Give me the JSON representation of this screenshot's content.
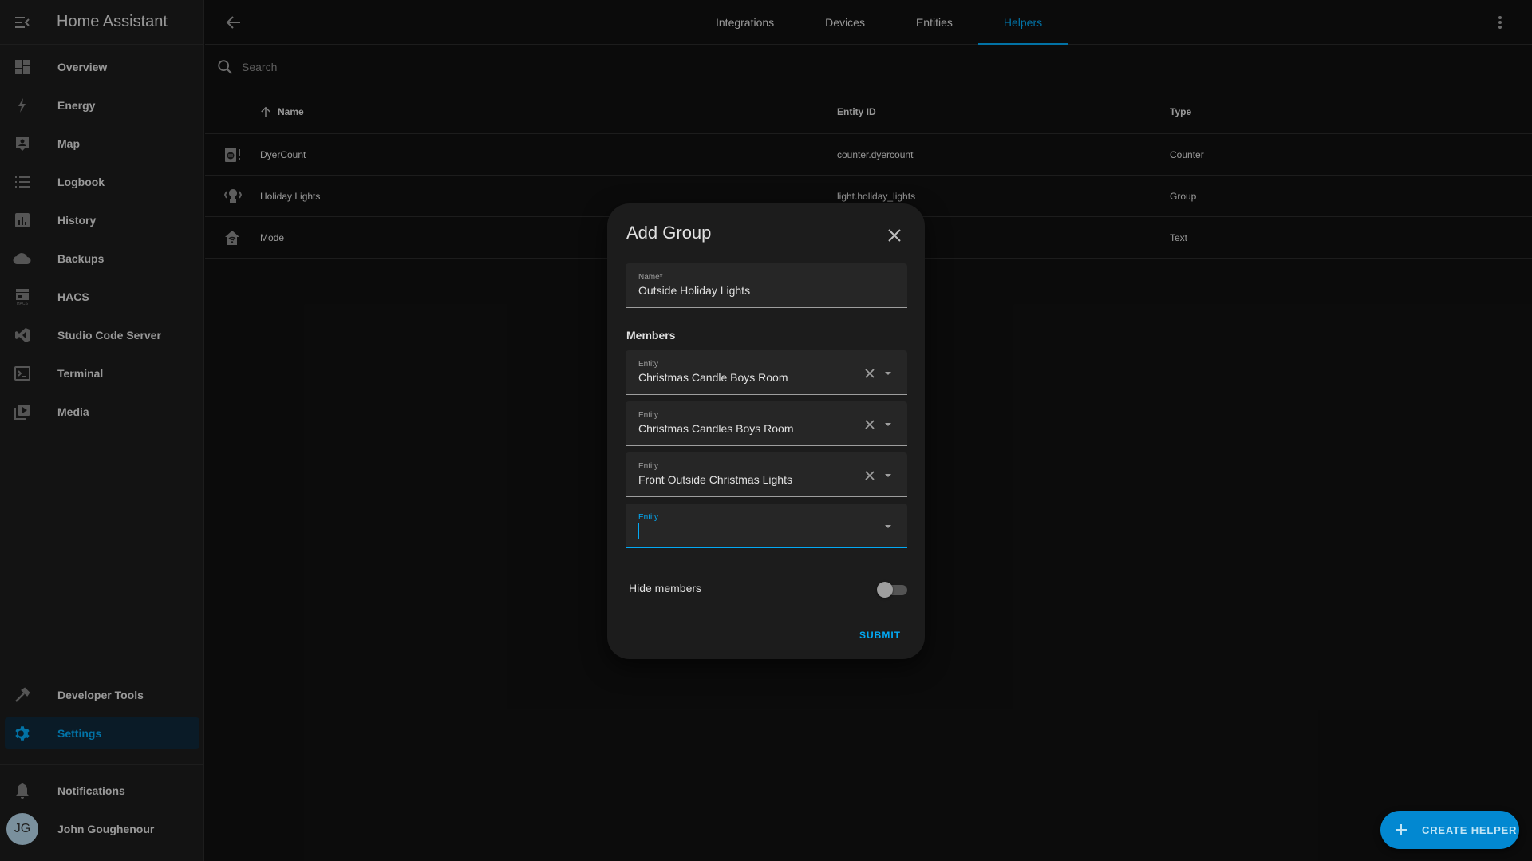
{
  "app": {
    "title": "Home Assistant"
  },
  "sidebar": {
    "items": [
      {
        "label": "Overview",
        "icon": "dashboard-icon"
      },
      {
        "label": "Energy",
        "icon": "lightning-bolt-icon"
      },
      {
        "label": "Map",
        "icon": "map-account-icon"
      },
      {
        "label": "Logbook",
        "icon": "list-icon"
      },
      {
        "label": "History",
        "icon": "chart-box-icon"
      },
      {
        "label": "Backups",
        "icon": "cloud-icon"
      },
      {
        "label": "HACS",
        "icon": "hacs-store-icon"
      },
      {
        "label": "Studio Code Server",
        "icon": "vscode-icon"
      },
      {
        "label": "Terminal",
        "icon": "console-icon"
      },
      {
        "label": "Media",
        "icon": "play-box-multiple-icon"
      }
    ],
    "bottom_items": [
      {
        "label": "Developer Tools",
        "icon": "hammer-icon"
      },
      {
        "label": "Settings",
        "icon": "gear-icon",
        "active": true
      }
    ],
    "notifications_label": "Notifications",
    "user": {
      "name": "John Goughenour",
      "initials": "JG"
    }
  },
  "header": {
    "tabs": [
      {
        "label": "Integrations"
      },
      {
        "label": "Devices"
      },
      {
        "label": "Entities"
      },
      {
        "label": "Helpers",
        "active": true
      }
    ]
  },
  "search": {
    "placeholder": "Search",
    "value": ""
  },
  "table": {
    "columns": {
      "name": "Name",
      "entity_id": "Entity ID",
      "type": "Type"
    },
    "sort": {
      "column": "Name",
      "direction": "ascending"
    },
    "rows": [
      {
        "icon": "counter-icon",
        "name": "DyerCount",
        "entity_id": "counter.dyercount",
        "type": "Counter"
      },
      {
        "icon": "lightbulb-group-icon",
        "name": "Holiday Lights",
        "entity_id": "light.holiday_lights",
        "type": "Group"
      },
      {
        "icon": "home-wifi-icon",
        "name": "Mode",
        "entity_id": "",
        "type": "Text"
      }
    ]
  },
  "dialog": {
    "title": "Add Group",
    "name_field": {
      "label": "Name*",
      "value": "Outside Holiday Lights"
    },
    "members_label": "Members",
    "members": [
      {
        "label": "Entity",
        "value": "Christmas Candle Boys Room"
      },
      {
        "label": "Entity",
        "value": "Christmas Candles Boys Room"
      },
      {
        "label": "Entity",
        "value": "Front Outside Christmas Lights"
      }
    ],
    "new_member": {
      "label": "Entity",
      "value": ""
    },
    "hide_members": {
      "label": "Hide members",
      "checked": false
    },
    "submit_label": "SUBMIT"
  },
  "fab": {
    "label": "CREATE HELPER"
  },
  "colors": {
    "accent": "#03a9f4",
    "fab": "#0288d1",
    "background": "#111111",
    "dialog": "#1c1c1c"
  }
}
